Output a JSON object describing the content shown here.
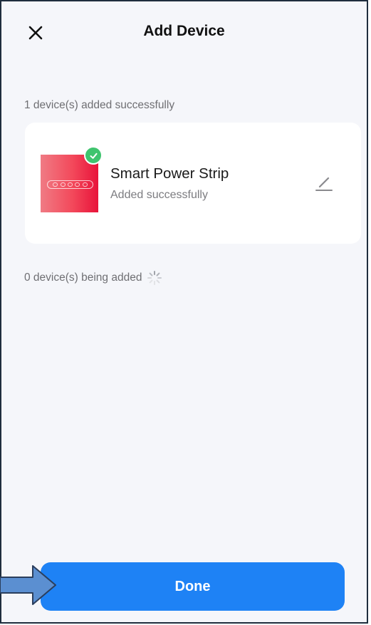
{
  "header": {
    "title": "Add Device",
    "close_icon": "close-icon"
  },
  "added_section": {
    "label": "1 device(s) added successfully"
  },
  "device": {
    "name": "Smart Power Strip",
    "status": "Added successfully",
    "image_icon": "power-strip-icon",
    "badge_icon": "check-icon",
    "edit_icon": "pencil-icon"
  },
  "adding_section": {
    "label": "0 device(s) being added",
    "spinner_icon": "loading-spinner-icon"
  },
  "footer": {
    "done_label": "Done"
  },
  "annotation": {
    "arrow_icon": "arrow-right-icon"
  },
  "colors": {
    "primary": "#1e82f5",
    "success": "#3fc46e",
    "background": "#f5f6fa",
    "card": "#ffffff",
    "arrow_fill": "#5b8fd1"
  }
}
